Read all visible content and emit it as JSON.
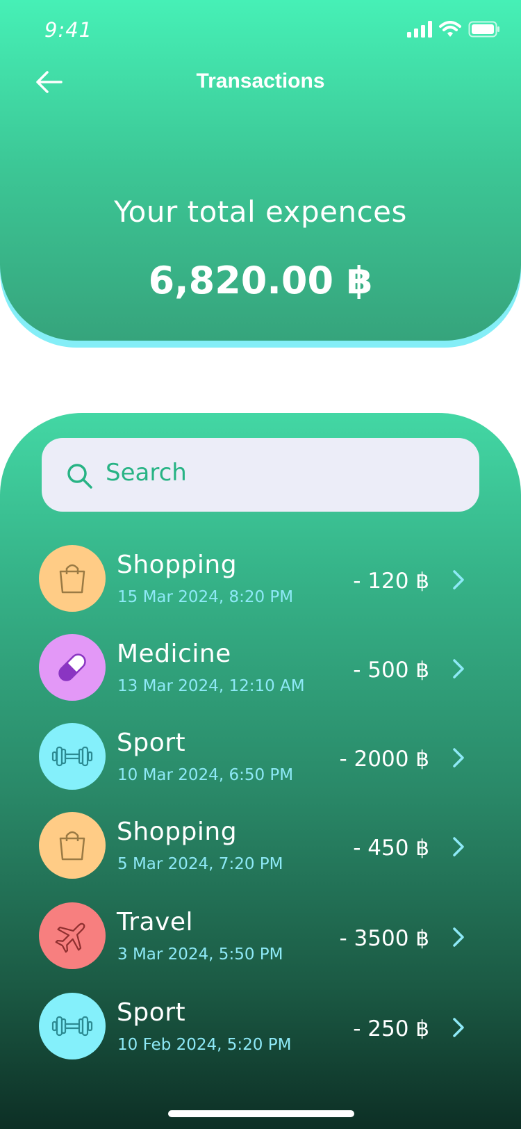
{
  "status_bar": {
    "time": "9:41"
  },
  "header": {
    "title": "Transactions",
    "total_label": "Your total expences",
    "total_value": "6,820.00 ฿"
  },
  "search": {
    "placeholder": "Search"
  },
  "transactions": [
    {
      "category": "Shopping",
      "date": "15 Mar 2024, 8:20 PM",
      "amount": "- 120 ฿",
      "icon": "shopping-bag-icon",
      "color": "#ffcc86"
    },
    {
      "category": "Medicine",
      "date": "13 Mar 2024, 12:10 AM",
      "amount": "- 500 ฿",
      "icon": "pill-icon",
      "color": "#e398f7"
    },
    {
      "category": "Sport",
      "date": "10 Mar 2024, 6:50 PM",
      "amount": "- 2000 ฿",
      "icon": "dumbbell-icon",
      "color": "#84f0fb"
    },
    {
      "category": "Shopping",
      "date": "5 Mar 2024, 7:20 PM",
      "amount": "- 450 ฿",
      "icon": "shopping-bag-icon",
      "color": "#ffcc86"
    },
    {
      "category": "Travel",
      "date": "3 Mar 2024, 5:50 PM",
      "amount": "- 3500 ฿",
      "icon": "airplane-icon",
      "color": "#f77f7f"
    },
    {
      "category": "Sport",
      "date": "10 Feb 2024, 5:20 PM",
      "amount": "- 250 ฿",
      "icon": "dumbbell-icon",
      "color": "#84f0fb"
    }
  ],
  "colors": {
    "accent": "#27b384",
    "header_top": "#46f0b6",
    "header_bottom": "#36a47c",
    "date_text": "#8ee9f7",
    "chevron": "#8ee9f7",
    "search_bg": "#ecedf8"
  }
}
